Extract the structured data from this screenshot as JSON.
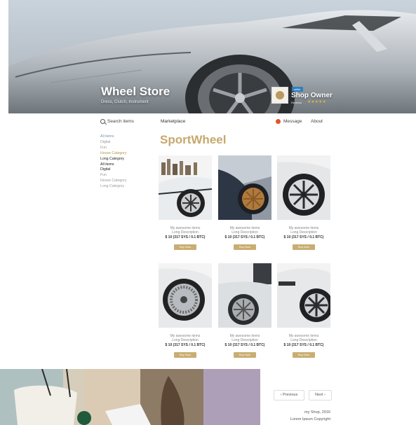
{
  "header": {
    "store_title": "Wheel Store",
    "store_subtitle": "Dress, Clutch, Instrument",
    "owner_badge": "seller",
    "owner_name": "Shop Owner",
    "owner_meta": "Reviews",
    "owner_stars": "★★★★★"
  },
  "nav": {
    "search_label": "Search items",
    "marketplace_tab": "Marketplace",
    "message_label": "Message",
    "about_label": "About"
  },
  "sidebar": {
    "categories": [
      {
        "label": "All items",
        "style": "blue"
      },
      {
        "label": "Digital",
        "style": "normal"
      },
      {
        "label": "Fun",
        "style": "normal"
      },
      {
        "label": "House Category",
        "style": "gold"
      },
      {
        "label": "Long Category",
        "style": "dark"
      },
      {
        "label": "All items",
        "style": "dark"
      },
      {
        "label": "Digital",
        "style": "dark"
      },
      {
        "label": "Fun",
        "style": "normal"
      },
      {
        "label": "House Category",
        "style": "normal"
      },
      {
        "label": "Long Category",
        "style": "normal"
      }
    ]
  },
  "main": {
    "heading": "SportWheel",
    "products": [
      {
        "name": "My awesome items",
        "desc": "Long Description",
        "price": "$ 10 (317 SYS / 0.1 BTC)",
        "buy_label": "Buy Now",
        "photo": "white-car-city"
      },
      {
        "name": "My awesome items",
        "desc": "Long Description",
        "price": "$ 10 (317 SYS / 0.1 BTC)",
        "buy_label": "Buy Now",
        "photo": "dark-car-bronze-wheel"
      },
      {
        "name": "My awesome items",
        "desc": "Long Description",
        "price": "$ 10 (317 SYS / 0.1 BTC)",
        "buy_label": "Buy Now",
        "photo": "white-car-black-wheel"
      },
      {
        "name": "My awesome items",
        "desc": "Long Description",
        "price": "$ 10 (317 SYS / 0.1 BTC)",
        "buy_label": "Buy Now",
        "photo": "white-car-mesh-wheel"
      },
      {
        "name": "My awesome items",
        "desc": "Long Description",
        "price": "$ 10 (317 SYS / 0.1 BTC)",
        "buy_label": "Buy Now",
        "photo": "silver-car-wheel"
      },
      {
        "name": "My awesome items",
        "desc": "Long Description",
        "price": "$ 10 (317 SYS / 0.1 BTC)",
        "buy_label": "Buy Now",
        "photo": "white-car-black-wheel-2"
      }
    ]
  },
  "pagination": {
    "previous_label": "‹ Previous",
    "next_label": "Next ›"
  },
  "footer": {
    "line1": "my Shop, 2016",
    "line2": "Lorem Ipsum Copyright"
  },
  "colors": {
    "accent_gold": "#c6a86b",
    "message_dot": "#e4532b",
    "seller_badge": "#2f7fc1"
  }
}
